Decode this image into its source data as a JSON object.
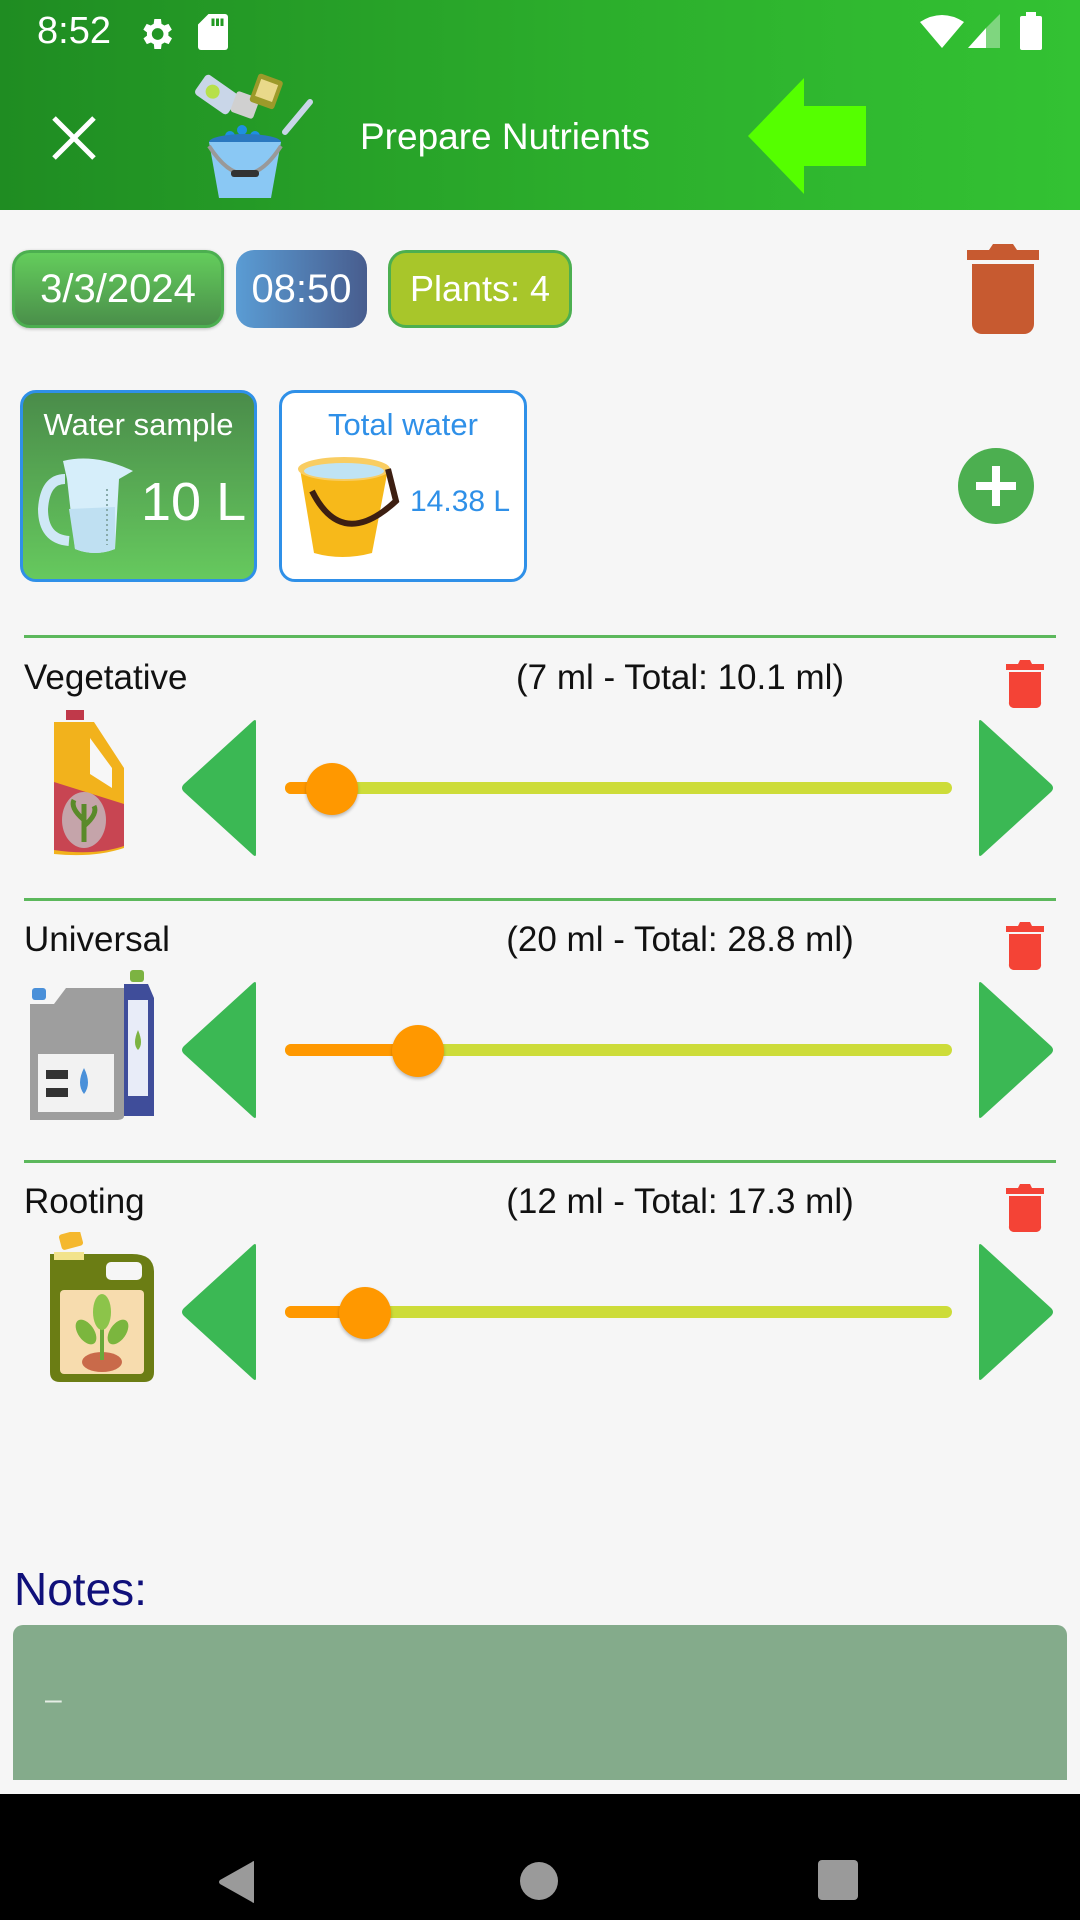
{
  "status_bar": {
    "time": "8:52",
    "icons": [
      "gear-icon",
      "sd-card-icon",
      "wifi-icon",
      "signal-icon",
      "battery-icon"
    ]
  },
  "header": {
    "title": "Prepare Nutrients",
    "close_icon": "close-icon",
    "back_icon": "arrow-left-icon",
    "colors": {
      "start": "#1f8c22",
      "end": "#33c233",
      "arrow": "#55ff00"
    }
  },
  "info_chips": {
    "date": "3/3/2024",
    "time": "08:50",
    "plants": "Plants: 4"
  },
  "water": {
    "sample": {
      "title": "Water sample",
      "value": "10 L"
    },
    "total": {
      "title": "Total water",
      "value": "14.38 L"
    }
  },
  "nutrients": [
    {
      "name": "Vegetative",
      "dose": "(7 ml - Total: 10.1 ml)",
      "slider_value": 7,
      "slider_max": 100,
      "icon": "vegetative-bottle-icon"
    },
    {
      "name": "Universal",
      "dose": "(20 ml - Total: 28.8 ml)",
      "slider_value": 20,
      "slider_max": 100,
      "icon": "universal-bottles-icon"
    },
    {
      "name": "Rooting",
      "dose": "(12 ml - Total: 17.3 ml)",
      "slider_value": 12,
      "slider_max": 100,
      "icon": "rooting-bottle-icon"
    }
  ],
  "notes": {
    "label": "Notes:",
    "value": "–"
  },
  "colors": {
    "delete_all": "#c75a30",
    "delete_item": "#f44336",
    "add": "#4caf50",
    "arrows": "#3bb854",
    "slider_active": "#ff9800",
    "slider_inactive": "#cddc39",
    "notes_bg": "#84ab8b"
  }
}
